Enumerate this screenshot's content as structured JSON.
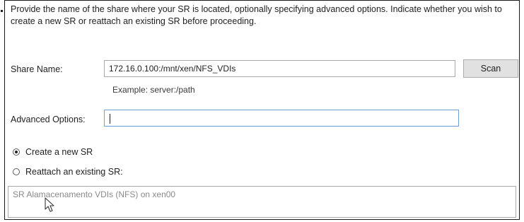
{
  "intro_text": "Provide the name of the share where your SR is located, optionally specifying advanced options. Indicate whether you wish to create a new SR or reattach an existing SR before proceeding.",
  "share_name": {
    "label": "Share Name:",
    "value": "172.16.0.100:/mnt/xen/NFS_VDIs",
    "hint": "Example: server:/path",
    "scan_label": "Scan"
  },
  "advanced_options": {
    "label": "Advanced Options:",
    "value": ""
  },
  "sr_mode": {
    "create_label": "Create a new SR",
    "reattach_label": "Reattach an existing SR:",
    "selected": "create"
  },
  "existing_srs": [
    "SR Alamacenamento VDIs (NFS) on xen00"
  ],
  "icons": {
    "pointer": "mouse-pointer-icon"
  }
}
